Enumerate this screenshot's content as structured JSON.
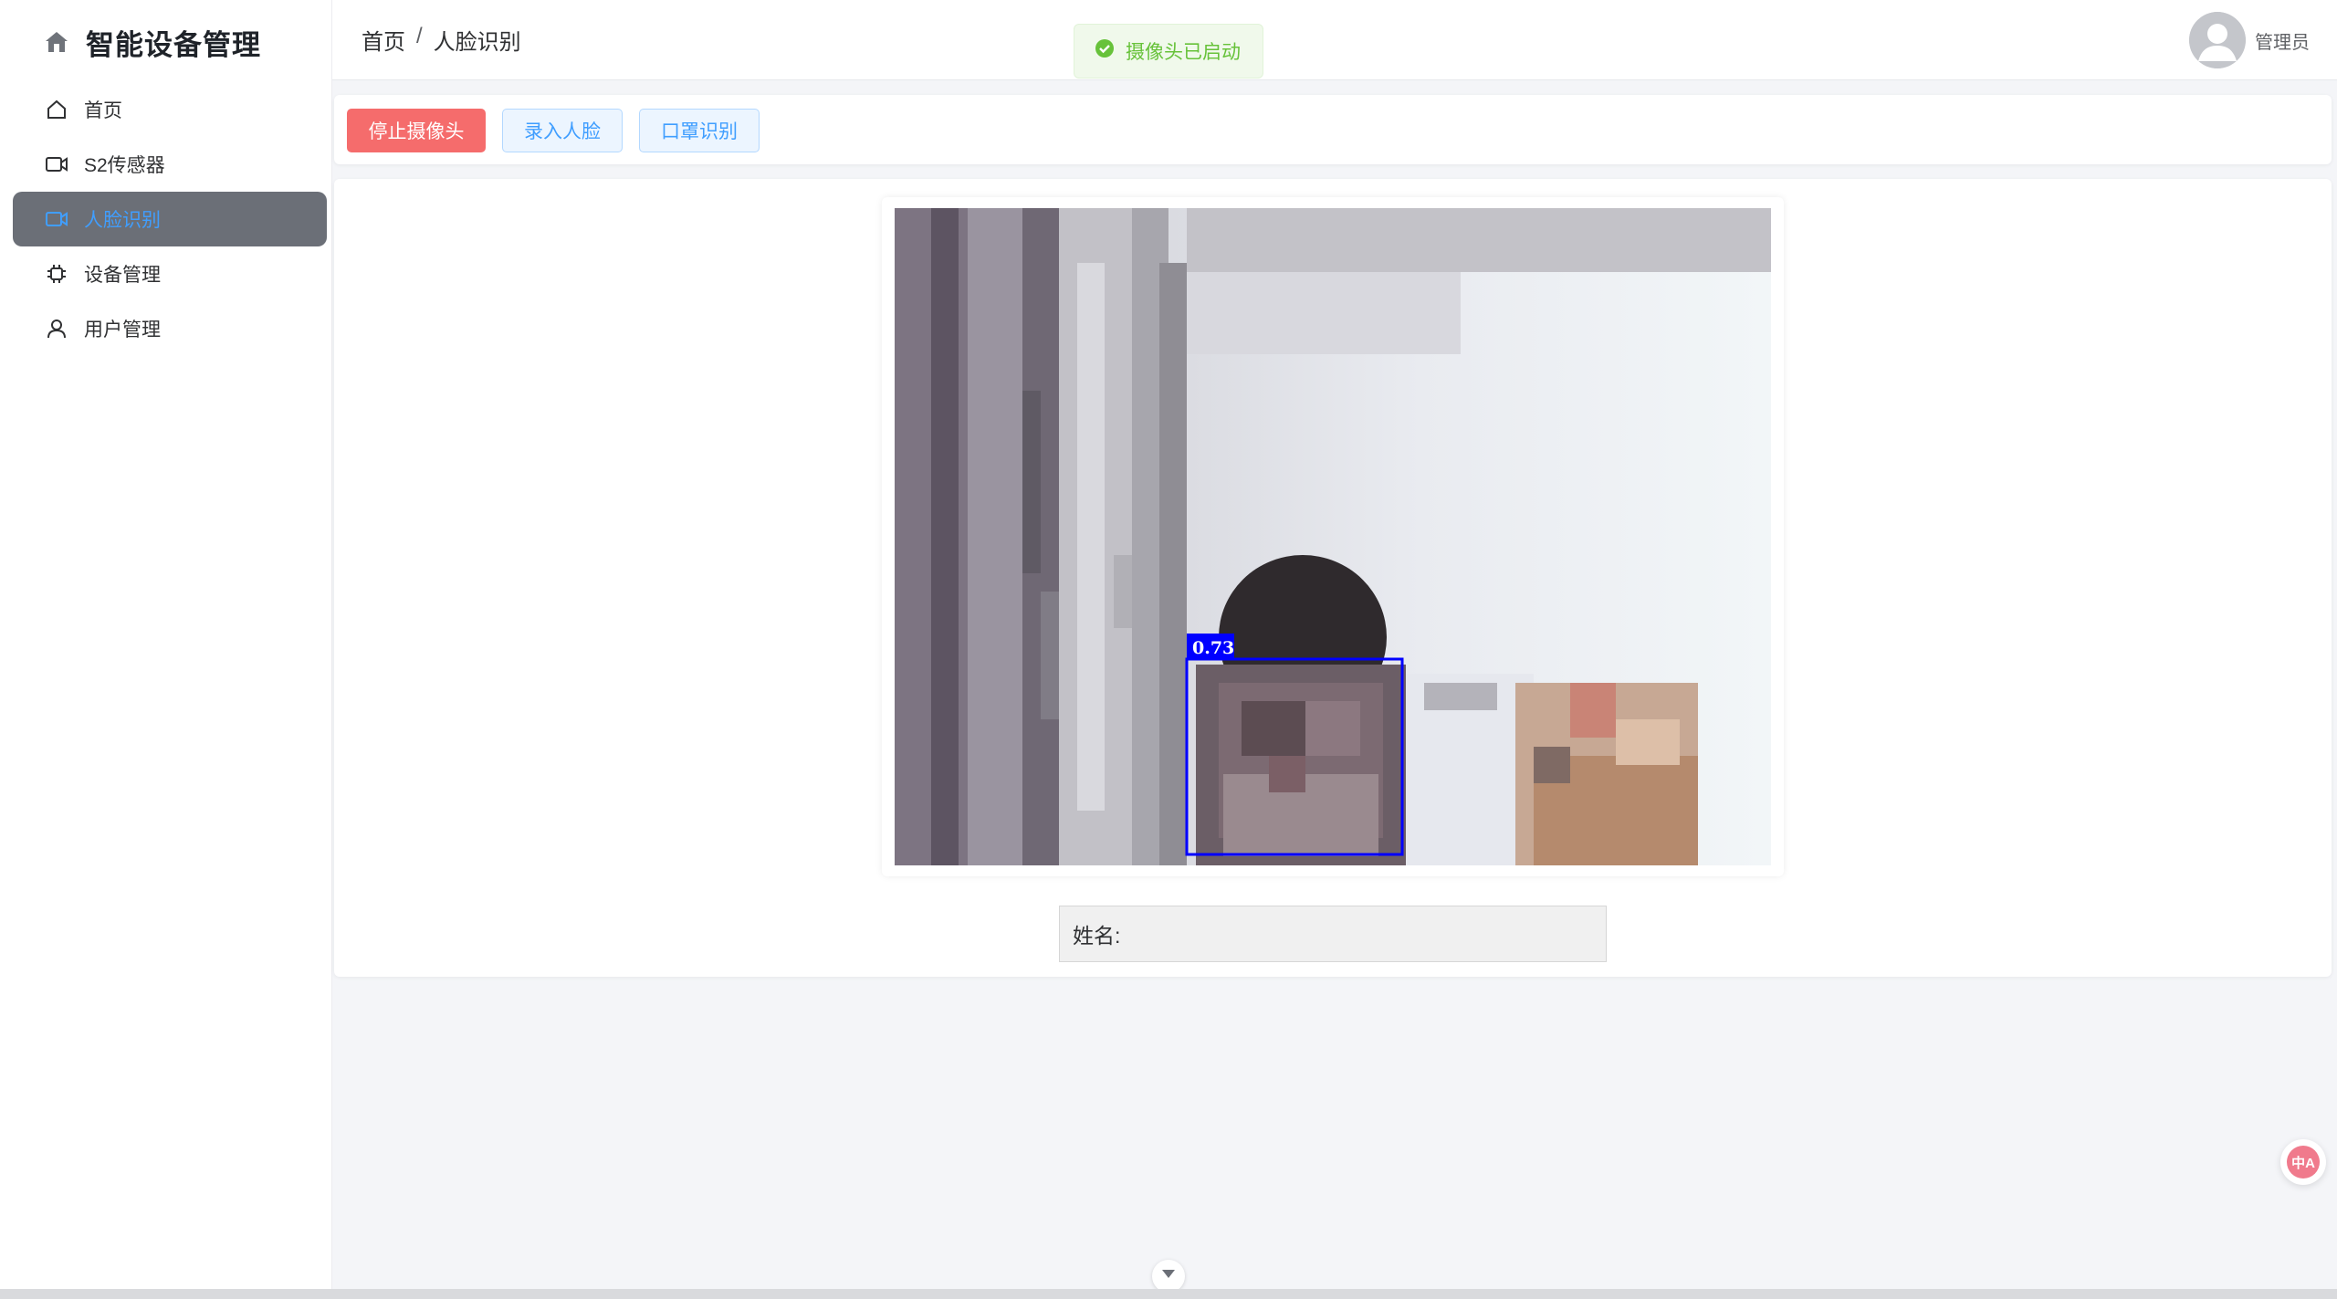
{
  "sidebar": {
    "app_title": "智能设备管理",
    "items": [
      {
        "label": "首页",
        "icon": "home-icon"
      },
      {
        "label": "S2传感器",
        "icon": "camera-icon"
      },
      {
        "label": "人脸识别",
        "icon": "camera-icon",
        "active": true
      },
      {
        "label": "设备管理",
        "icon": "chip-icon"
      },
      {
        "label": "用户管理",
        "icon": "user-icon"
      }
    ]
  },
  "header": {
    "breadcrumb": [
      "首页",
      "人脸识别"
    ],
    "breadcrumb_separator": "/",
    "toast": "摄像头已启动",
    "user_name": "管理员"
  },
  "toolbar": {
    "stop_camera_label": "停止摄像头",
    "enroll_face_label": "录入人脸",
    "mask_detect_label": "口罩识别"
  },
  "video": {
    "detection_confidence": "0.73",
    "box_color": "#0000ff"
  },
  "name_field": {
    "label": "姓名:",
    "value": ""
  },
  "float_button": {
    "glyph": "中A"
  },
  "colors": {
    "accent": "#409eff",
    "danger": "#f56c6c",
    "success": "#67c23a",
    "active_menu_bg": "#6b6f77"
  }
}
